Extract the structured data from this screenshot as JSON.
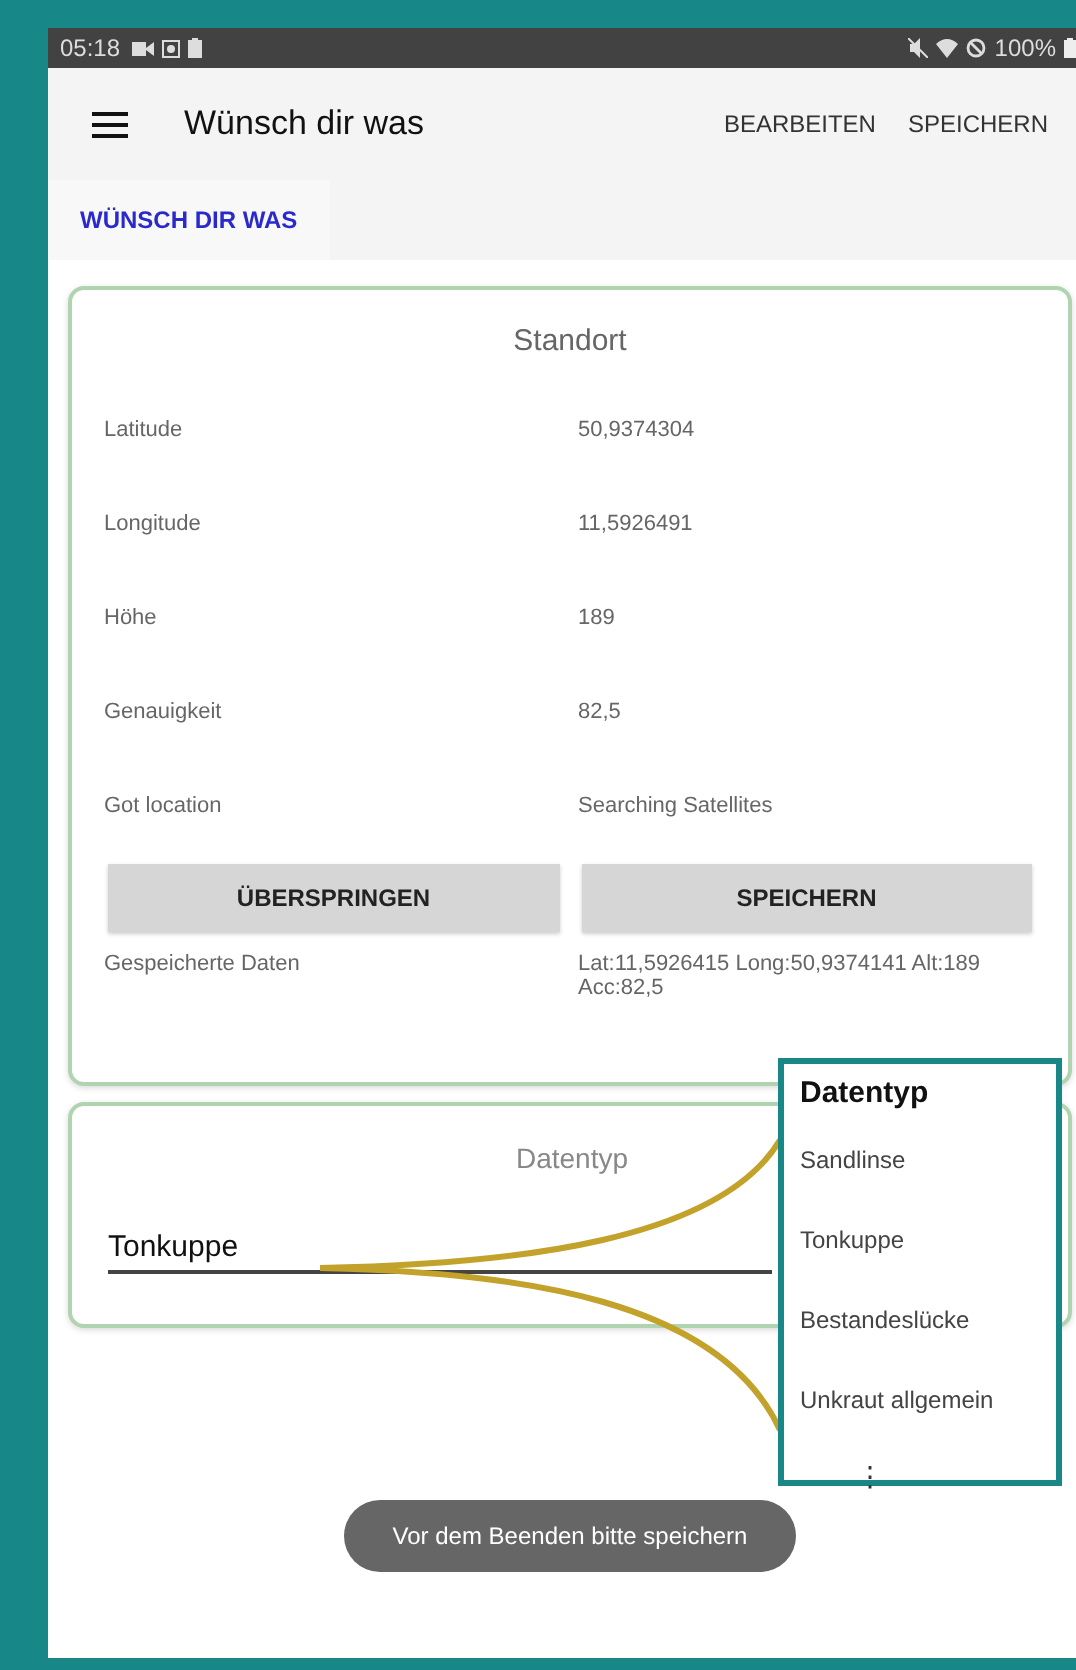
{
  "status_bar": {
    "time": "05:18",
    "battery": "100%"
  },
  "app_bar": {
    "title": "Wünsch dir was",
    "actions": [
      "BEARBEITEN",
      "SPEICHERN"
    ]
  },
  "tabs": [
    {
      "label": "WÜNSCH DIR WAS",
      "selected": true
    }
  ],
  "location_card": {
    "title": "Standort",
    "rows": [
      {
        "label": "Latitude",
        "value": "50,9374304"
      },
      {
        "label": "Longitude",
        "value": "11,5926491"
      },
      {
        "label": "Höhe",
        "value": "189"
      },
      {
        "label": "Genauigkeit",
        "value": "82,5"
      },
      {
        "label": "Got location",
        "value": "Searching Satellites"
      }
    ],
    "buttons": [
      "ÜBERSPRINGEN",
      "SPEICHERN"
    ],
    "saved_label": "Gespeicherte Daten",
    "saved_value": "Lat:11,5926415 Long:50,9374141 Alt:189 Acc:82,5"
  },
  "datatype_card": {
    "title": "Datentyp",
    "value": "Tonkuppe"
  },
  "callout": {
    "title": "Datentyp",
    "options": [
      "Sandlinse",
      "Tonkuppe",
      "Bestandeslücke",
      "Unkraut allgemein"
    ],
    "more": "⋮"
  },
  "toast": "Vor dem Beenden bitte speichern"
}
